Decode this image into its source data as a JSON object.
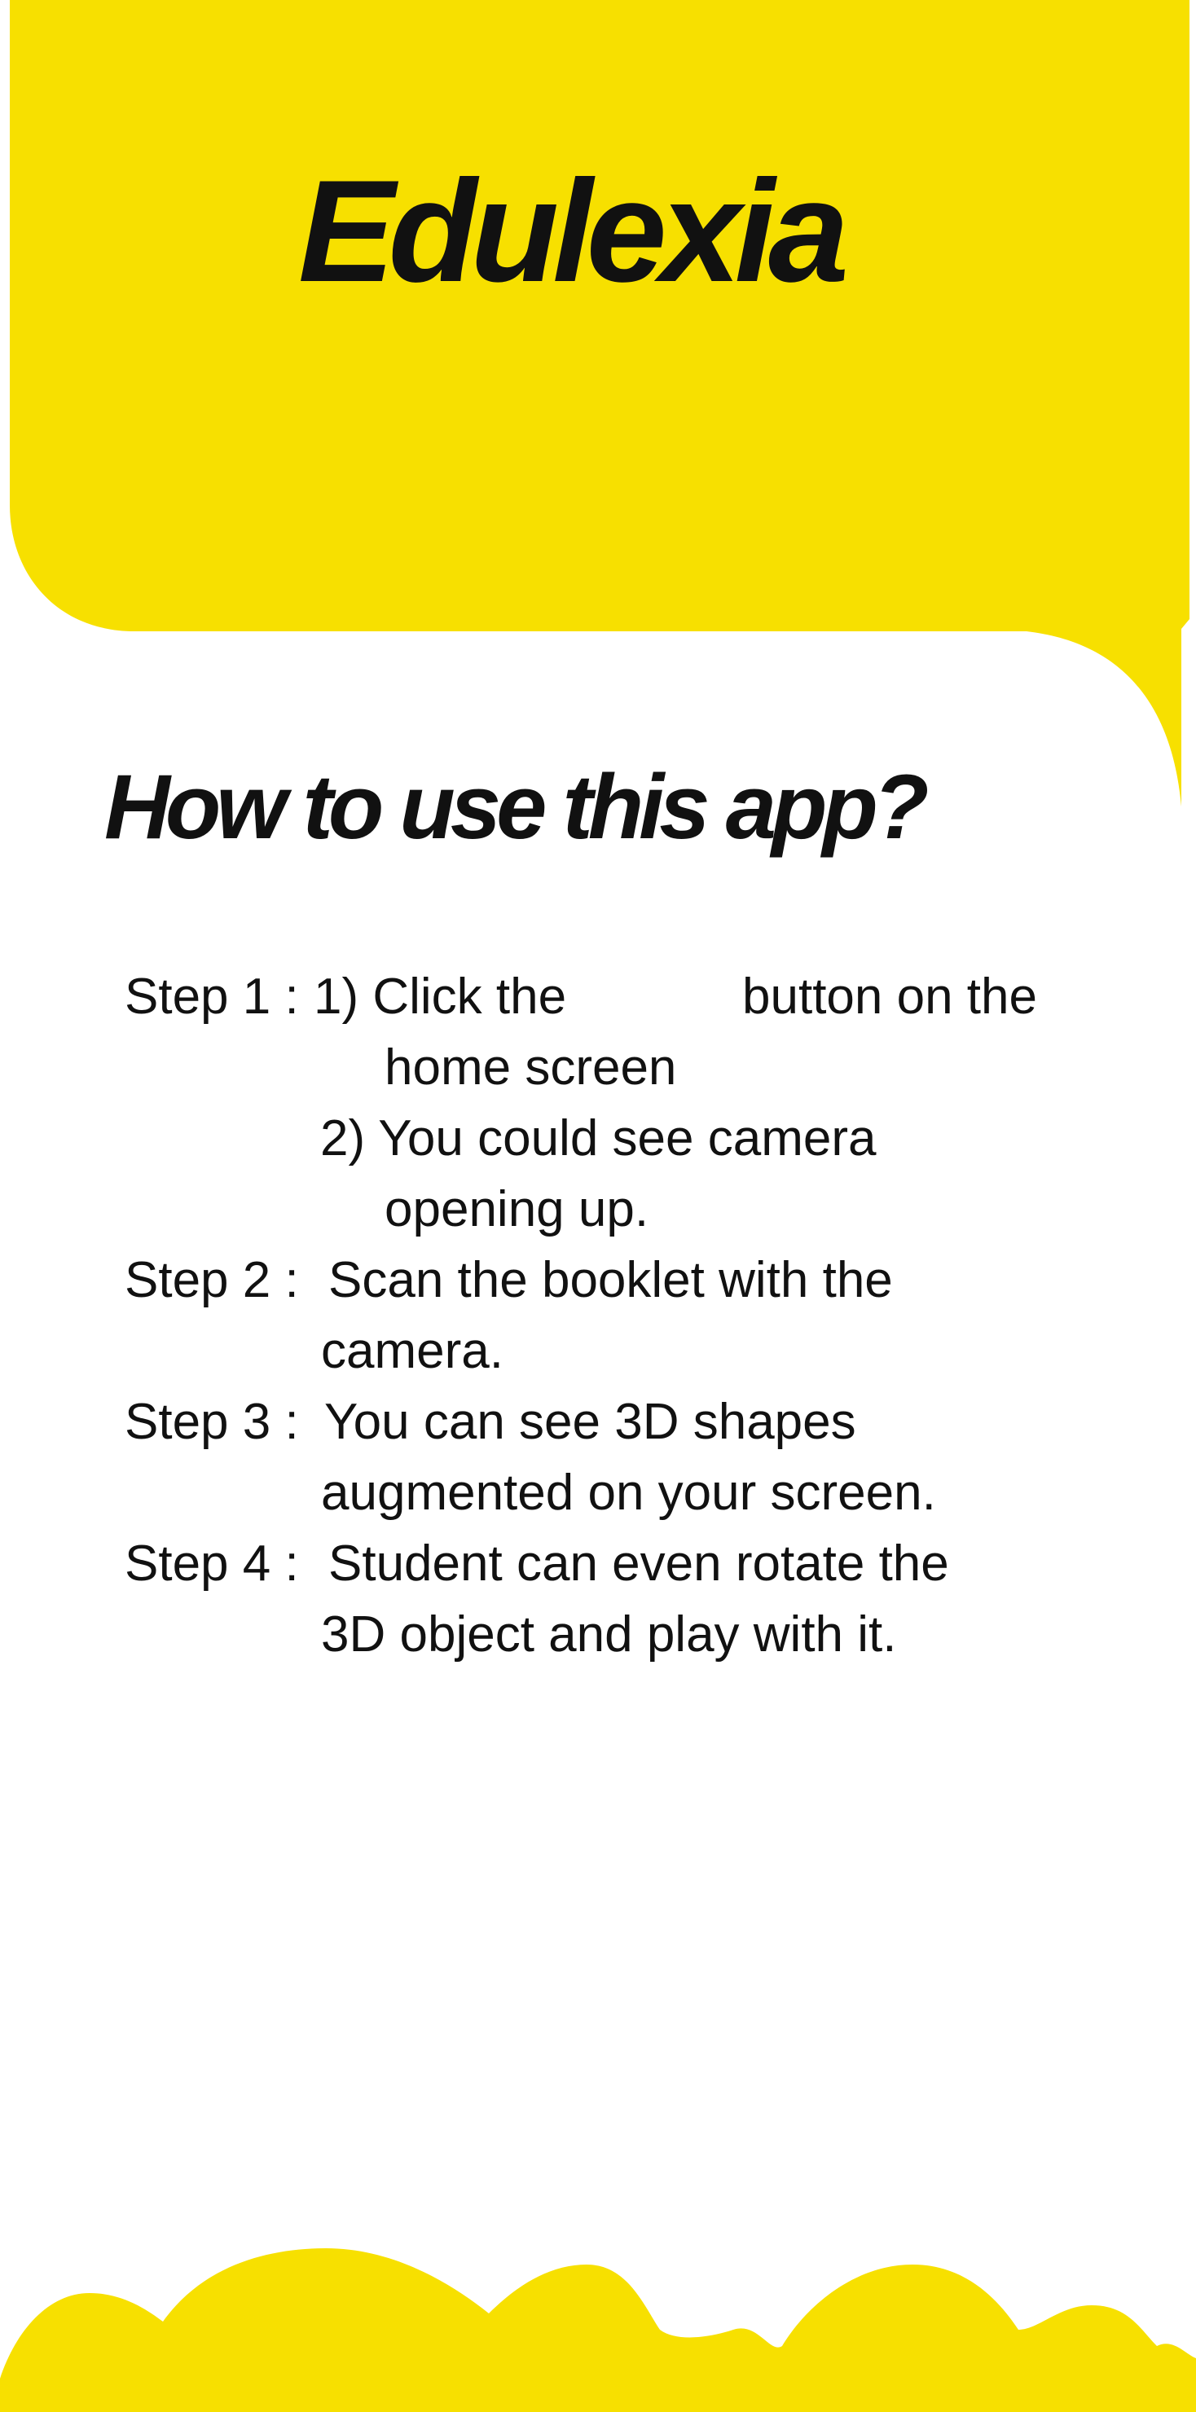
{
  "app": {
    "title": "Edulexia"
  },
  "instructions": {
    "heading": "How to use this app?",
    "step1": {
      "label": "Step 1 :",
      "line1_prefix": "1) Click the",
      "line1_suffix": "button on the",
      "line2": "home screen",
      "line3": "2) You could see camera",
      "line4": "opening up."
    },
    "step2": {
      "label": "Step 2 :",
      "line1": "Scan the booklet with the",
      "line2": "camera."
    },
    "step3": {
      "label": "Step 3 :",
      "line1": "You can see 3D shapes",
      "line2": "augmented on your screen."
    },
    "step4": {
      "label": "Step 4 :",
      "line1": "Student can even rotate the",
      "line2": "3D object  and play with it."
    }
  },
  "colors": {
    "accent_yellow": "#F7E000",
    "text": "#111111",
    "background": "#FFFFFF"
  }
}
